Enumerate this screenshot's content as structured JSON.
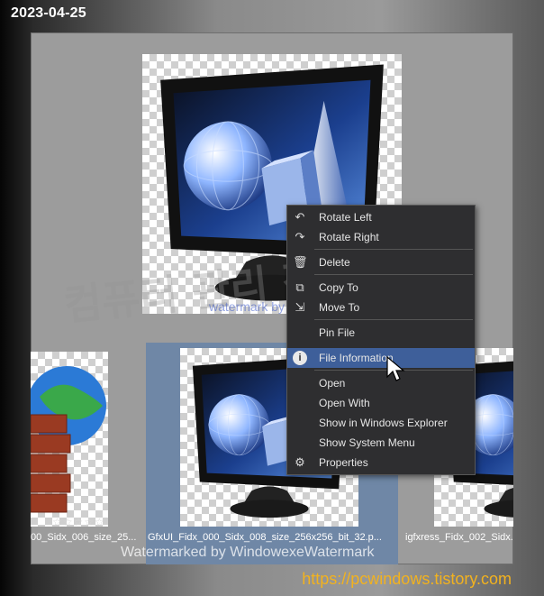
{
  "overlay": {
    "date": "2023-04-25",
    "url": "https://pcwindows.tistory.com",
    "watermark_bottom": "Watermarked by WindowexeWatermark",
    "watermark_center": "watermark by windowexe",
    "watermark_korean": "컴퓨터 관리 정보"
  },
  "thumbnails": [
    {
      "caption": "00_Sidx_006_size_25...",
      "rating_stars": "☆☆☆☆☆"
    },
    {
      "caption": "GfxUI_Fidx_000_Sidx_008_size_256x256_bit_32.p...",
      "selected": true
    },
    {
      "caption": "igfxress_Fidx_002_Sidx..."
    }
  ],
  "context_menu": {
    "items": [
      {
        "label": "Rotate Left",
        "icon": "rotate-left-icon"
      },
      {
        "label": "Rotate Right",
        "icon": "rotate-right-icon"
      },
      {
        "label": "Delete",
        "icon": "trash-icon"
      },
      {
        "label": "Copy To",
        "icon": "copy-to-icon"
      },
      {
        "label": "Move To",
        "icon": "move-to-icon"
      },
      {
        "label": "Pin File",
        "icon": ""
      },
      {
        "label": "File Information",
        "icon": "info-icon",
        "highlighted": true
      },
      {
        "label": "Open",
        "icon": ""
      },
      {
        "label": "Open With",
        "icon": ""
      },
      {
        "label": "Show in Windows Explorer",
        "icon": ""
      },
      {
        "label": "Show System Menu",
        "icon": ""
      },
      {
        "label": "Properties",
        "icon": "properties-icon"
      }
    ]
  },
  "colors": {
    "menu_bg": "#2e2e30",
    "menu_highlight": "#3e5f9a",
    "selection_tile": "#6f87a6",
    "url_color": "#f2b21f"
  }
}
